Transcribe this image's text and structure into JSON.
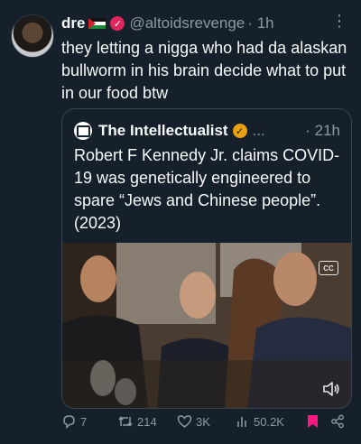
{
  "author": {
    "name": "dre",
    "handle": "@altoidsrevenge",
    "time": "· 1h"
  },
  "tweet_text": "they letting a nigga who had da alaskan bullworm in his brain decide what to put in our food btw",
  "quote": {
    "name": "The Intellectualist",
    "dots": "...",
    "time": "· 21h",
    "text": "Robert F Kennedy Jr. claims COVID-19 was genetically engineered to spare “Jews and Chinese people”. (2023)",
    "media": {
      "cc_label": "CC"
    }
  },
  "actions": {
    "replies": "7",
    "retweets": "214",
    "likes": "3K",
    "views": "50.2K"
  },
  "colors": {
    "background": "#15202b",
    "text": "#f7f9f9",
    "secondary": "#8b98a5",
    "border": "#38444d",
    "bookmark": "#f91880"
  }
}
